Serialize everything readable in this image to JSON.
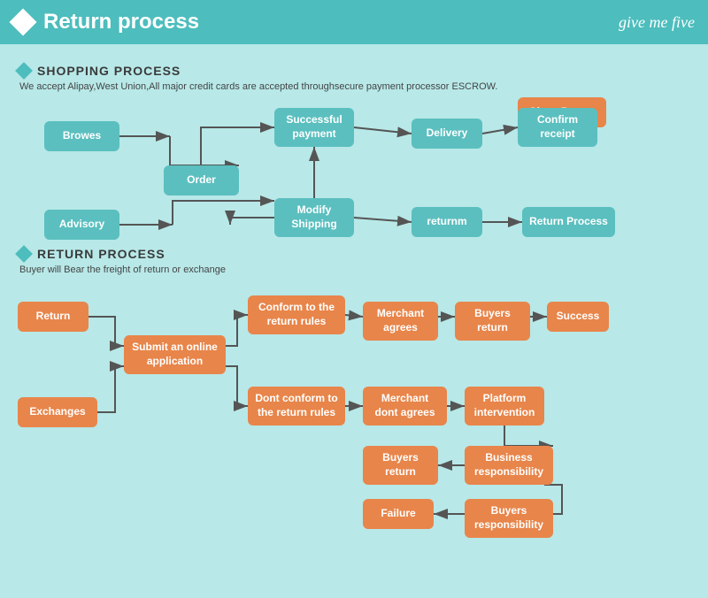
{
  "header": {
    "diamond": "",
    "title": "Return process",
    "logo": "give me five"
  },
  "shopping": {
    "section_title": "SHOPPING PROCESS",
    "section_desc": "We accept Alipay,West Union,All major credit cards are accepted throughsecure payment processor ESCROW.",
    "boxes": {
      "browes": "Browes",
      "order": "Order",
      "advisory": "Advisory",
      "modify": "Modify Shipping",
      "successful": "Successful payment",
      "delivery": "Delivery",
      "given": "Given 5 stars",
      "confirm": "Confirm receipt",
      "returnm": "returnm",
      "returnp": "Return Process"
    }
  },
  "return": {
    "section_title": "RETURN PROCESS",
    "section_desc": "Buyer will Bear the freight of return or exchange",
    "boxes": {
      "return": "Return",
      "submit": "Submit an online application",
      "exchanges": "Exchanges",
      "conform": "Conform to the return rules",
      "merchant_ag": "Merchant agrees",
      "buyers_r1": "Buyers return",
      "success": "Success",
      "dontconform": "Dont conform to the return rules",
      "merchant_dont": "Merchant dont agrees",
      "platform": "Platform intervention",
      "buyers_r2": "Buyers return",
      "business": "Business responsibility",
      "failure": "Failure",
      "buyers_resp": "Buyers responsibility"
    }
  }
}
